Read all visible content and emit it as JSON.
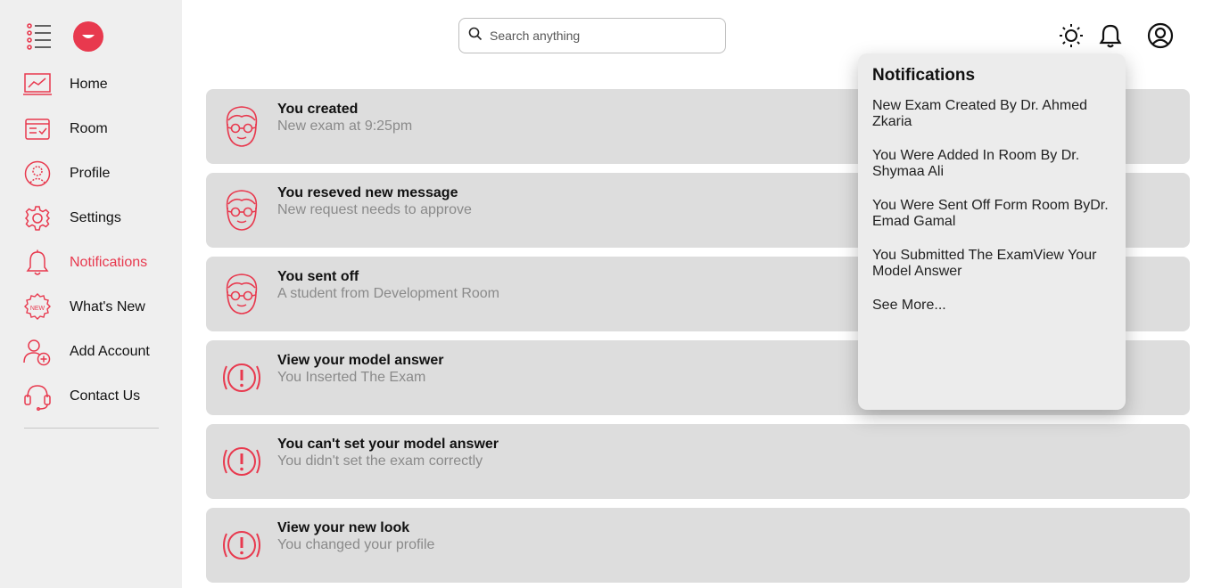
{
  "sidebar": {
    "items": [
      {
        "label": "Home",
        "icon": "home-chart-icon"
      },
      {
        "label": "Room",
        "icon": "room-icon"
      },
      {
        "label": "Profile",
        "icon": "profile-icon"
      },
      {
        "label": "Settings",
        "icon": "gear-icon"
      },
      {
        "label": "Notifications",
        "icon": "bell-icon",
        "active": true
      },
      {
        "label": "What's New",
        "icon": "new-badge-icon"
      },
      {
        "label": "Add Account",
        "icon": "add-user-icon"
      },
      {
        "label": "Contact Us",
        "icon": "headset-icon"
      }
    ]
  },
  "search": {
    "placeholder": "Search anything"
  },
  "cards": [
    {
      "title": "You created",
      "subtitle": "New exam at 9:25pm",
      "icon": "person-glasses-icon"
    },
    {
      "title": "You reseved new message",
      "subtitle": "New request needs to approve",
      "icon": "person-glasses-icon"
    },
    {
      "title": "You sent off",
      "subtitle": "A student from Development Room",
      "icon": "person-glasses-icon"
    },
    {
      "title": "View your model answer",
      "subtitle": "You Inserted The Exam",
      "icon": "alert-icon"
    },
    {
      "title": "You can't set your model answer",
      "subtitle": "You didn't set the exam correctly",
      "icon": "alert-icon"
    },
    {
      "title": "View your new look",
      "subtitle": "You changed your profile",
      "icon": "alert-icon"
    }
  ],
  "popup": {
    "title": "Notifications",
    "items": [
      "New Exam Created By Dr. Ahmed Zkaria",
      "You Were Added In Room By Dr. Shymaa Ali",
      "You Were Sent Off Form Room ByDr. Emad Gamal",
      "You Submitted The ExamView Your Model Answer"
    ],
    "see_more": "See More..."
  },
  "colors": {
    "accent": "#e8394e",
    "sidebar_bg": "#efefef",
    "card_bg": "#dddddd",
    "popup_bg": "#ececec"
  }
}
